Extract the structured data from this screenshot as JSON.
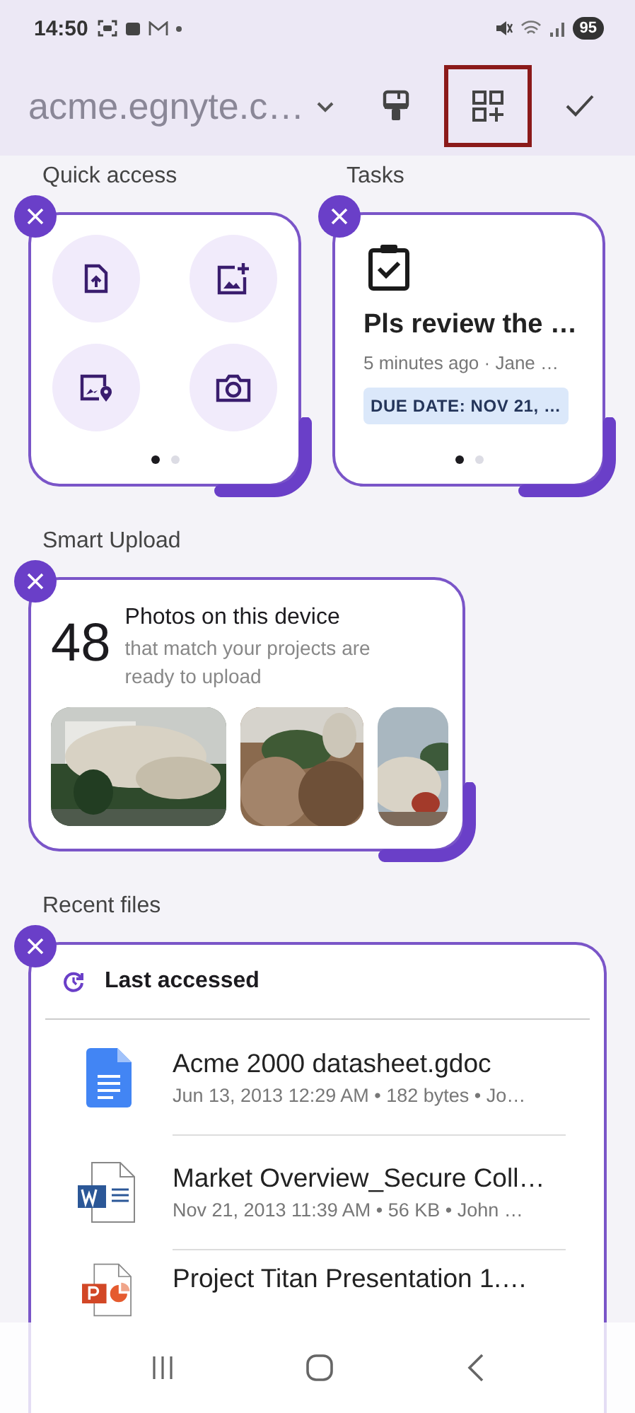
{
  "status_bar": {
    "time": "14:50",
    "battery": "95"
  },
  "toolbar": {
    "title": "acme.egnyte.c…",
    "actions": [
      {
        "kind": "brush",
        "highlighted": false
      },
      {
        "kind": "add-widget",
        "highlighted": true
      },
      {
        "kind": "check",
        "highlighted": false
      }
    ]
  },
  "quick_access": {
    "title": "Quick access",
    "actions": [
      {
        "kind": "upload"
      },
      {
        "kind": "add-image"
      },
      {
        "kind": "image-location"
      },
      {
        "kind": "camera"
      }
    ],
    "pager": [
      {
        "selected": true
      },
      {
        "selected": false
      }
    ]
  },
  "tasks": {
    "title": "Tasks",
    "task": {
      "title": "Pls review the …",
      "meta": "5 minutes ago · Jane …",
      "due": "DUE DATE: NOV 21, …"
    },
    "pager": [
      {
        "selected": true
      },
      {
        "selected": false
      }
    ]
  },
  "smart_upload": {
    "title": "Smart Upload",
    "count": "48",
    "headline": "Photos on this device",
    "subtitle": "that match your projects are ready to upload"
  },
  "recent_files": {
    "title": "Recent files",
    "header": "Last accessed",
    "files": [
      {
        "kind": "gdoc",
        "name": "Acme 2000 datasheet.gdoc",
        "meta": "Jun 13, 2013 12:29 AM • 182 bytes • Jo…"
      },
      {
        "kind": "word",
        "name": "Market Overview_Secure Coll…",
        "meta": "Nov 21, 2013 11:39 AM • 56 KB • John …"
      },
      {
        "kind": "powerpoint",
        "name": "Project Titan Presentation 1.…"
      }
    ]
  }
}
